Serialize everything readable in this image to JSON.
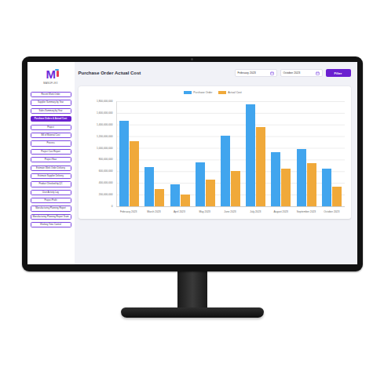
{
  "logo": {
    "mark": "M",
    "name": "MANUFLEX"
  },
  "sidebar": {
    "items": [
      {
        "label": "Recent Work Order",
        "selected": false
      },
      {
        "label": "Supplier Summary by Year",
        "selected": false
      },
      {
        "label": "Sales Summary by Year",
        "selected": false
      },
      {
        "label": "Purchase Orders & Actual Cost",
        "selected": true
      },
      {
        "label": "Project",
        "selected": false
      },
      {
        "label": "Bill of Material Cost",
        "selected": false
      },
      {
        "label": "Process",
        "selected": false
      },
      {
        "label": "Project Cost Report",
        "selected": false
      },
      {
        "label": "Project Hour",
        "selected": false
      },
      {
        "label": "Estimate Work Order Delivery",
        "selected": false
      },
      {
        "label": "Estimate Supplier Delivery",
        "selected": false
      },
      {
        "label": "Product Checked by QC",
        "selected": false
      },
      {
        "label": "User Activity Log",
        "selected": false
      },
      {
        "label": "Project Profit",
        "selected": false
      },
      {
        "label": "Manufacturing Planning Report",
        "selected": false
      },
      {
        "label": "Manufacturing Planning Report Team",
        "selected": false
      },
      {
        "label": "Working Time Control",
        "selected": false
      }
    ]
  },
  "header": {
    "title": "Purchase Order Actual Cost",
    "date_from": "February 2023",
    "date_to": "October 2023",
    "filter_button": "Filter"
  },
  "chart": {
    "y_ticks": [
      "1,800,000,000",
      "1,600,000,000",
      "1,400,000,000",
      "1,200,000,000",
      "1,000,000,000",
      "800,000,000",
      "600,000,000",
      "400,000,000",
      "200,000,000",
      "0"
    ],
    "y_max": 1800000000,
    "x_labels": [
      "February 2023",
      "March 2023",
      "April 2023",
      "May 2023",
      "June 2023",
      "July 2023",
      "August 2023",
      "September 2023",
      "October 2023"
    ],
    "series": [
      {
        "name": "Purchase Order",
        "color": "#41a5ee",
        "values": [
          1460000000,
          670000000,
          380000000,
          750000000,
          1210000000,
          1750000000,
          930000000,
          980000000,
          640000000
        ]
      },
      {
        "name": "Actual Cost",
        "color": "#f0a93a",
        "values": [
          1110000000,
          300000000,
          200000000,
          460000000,
          600000000,
          1360000000,
          640000000,
          740000000,
          340000000
        ]
      }
    ]
  }
}
